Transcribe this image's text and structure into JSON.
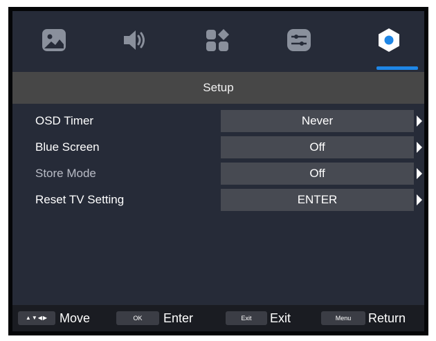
{
  "tabs": [
    {
      "name": "picture",
      "icon": "picture-icon"
    },
    {
      "name": "sound",
      "icon": "speaker-icon"
    },
    {
      "name": "channel",
      "icon": "apps-grid-icon"
    },
    {
      "name": "function",
      "icon": "sliders-icon"
    },
    {
      "name": "setup",
      "icon": "gear-icon",
      "selected": true
    }
  ],
  "menu_title": "Setup",
  "rows": [
    {
      "label": "OSD Timer",
      "value": "Never"
    },
    {
      "label": "Blue Screen",
      "value": "Off"
    },
    {
      "label": "Store Mode",
      "value": "Off",
      "dimmed": true
    },
    {
      "label": "Reset TV Setting",
      "value": "ENTER"
    }
  ],
  "footer": {
    "move_key": "▲▼◀▶",
    "move_label": "Move",
    "ok_key": "OK",
    "enter_label": "Enter",
    "exit_key": "Exit",
    "exit_label": "Exit",
    "menu_key": "Menu",
    "return_label": "Return"
  },
  "colors": {
    "background": "#262b38",
    "title_bar": "#474747",
    "value_box": "#474a52",
    "accent": "#1e86e6"
  }
}
